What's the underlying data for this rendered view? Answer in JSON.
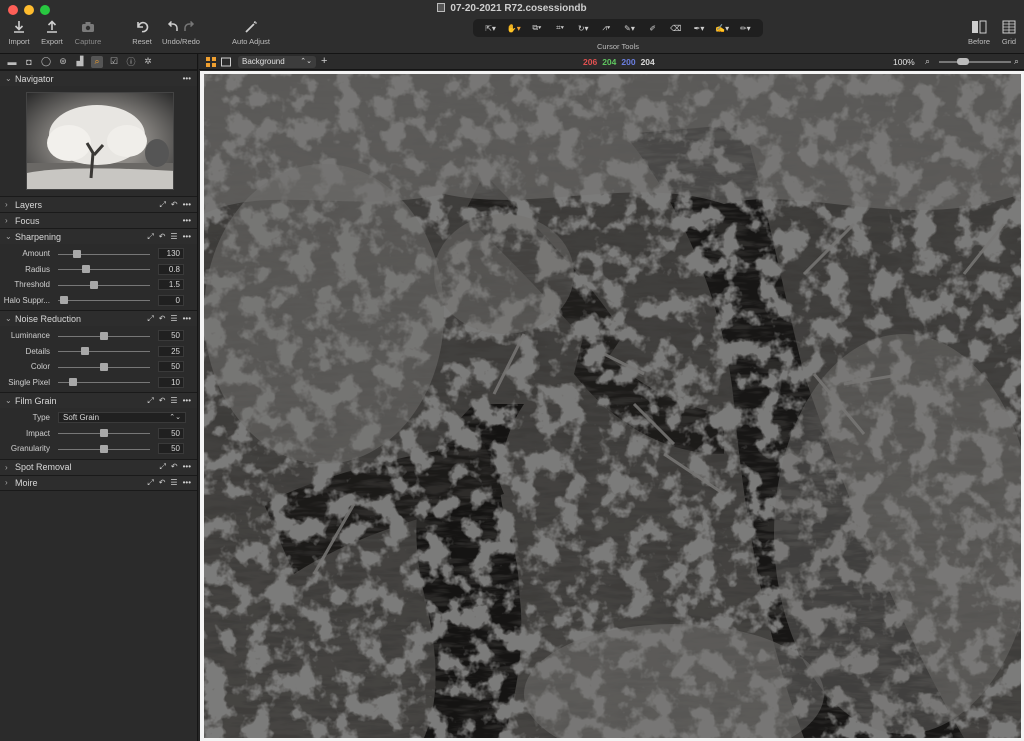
{
  "window": {
    "title": "07-20-2021 R72.cosessiondb",
    "traffic_lights": [
      "#fe5f57",
      "#febc2e",
      "#28c840"
    ]
  },
  "toolbar": {
    "import_label": "Import",
    "export_label": "Export",
    "capture_label": "Capture",
    "reset_label": "Reset",
    "undo_redo_label": "Undo/Redo",
    "auto_adjust_label": "Auto Adjust",
    "cursor_tools_label": "Cursor Tools",
    "before_label": "Before",
    "grid_label": "Grid"
  },
  "cursor_tools": [
    "select-icon",
    "pan-icon",
    "loupe-icon",
    "crop-icon",
    "rotate-icon",
    "keystone-icon",
    "picker-icon",
    "brush-icon",
    "eraser-icon",
    "gradient-icon",
    "color-picker-icon",
    "annotation-icon"
  ],
  "viewer_bar": {
    "layer": "Background",
    "rgb": {
      "r": "206",
      "g": "204",
      "b": "200",
      "l": "204"
    },
    "zoom": "100%",
    "zoom_level": 0.3
  },
  "panels": {
    "navigator": {
      "title": "Navigator"
    },
    "layers": {
      "title": "Layers"
    },
    "focus": {
      "title": "Focus"
    },
    "sharpening": {
      "title": "Sharpening",
      "rows": [
        {
          "label": "Amount",
          "value": "130",
          "pos": 0.18
        },
        {
          "label": "Radius",
          "value": "0.8",
          "pos": 0.28
        },
        {
          "label": "Threshold",
          "value": "1.5",
          "pos": 0.38
        },
        {
          "label": "Halo Suppr...",
          "value": "0",
          "pos": 0.02
        }
      ]
    },
    "noise_reduction": {
      "title": "Noise Reduction",
      "rows": [
        {
          "label": "Luminance",
          "value": "50",
          "pos": 0.5
        },
        {
          "label": "Details",
          "value": "25",
          "pos": 0.27
        },
        {
          "label": "Color",
          "value": "50",
          "pos": 0.5
        },
        {
          "label": "Single Pixel",
          "value": "10",
          "pos": 0.13
        }
      ]
    },
    "film_grain": {
      "title": "Film Grain",
      "type_label": "Type",
      "type_value": "Soft Grain",
      "rows": [
        {
          "label": "Impact",
          "value": "50",
          "pos": 0.5
        },
        {
          "label": "Granularity",
          "value": "50",
          "pos": 0.5
        }
      ]
    },
    "spot_removal": {
      "title": "Spot Removal"
    },
    "moire": {
      "title": "Moire"
    }
  }
}
